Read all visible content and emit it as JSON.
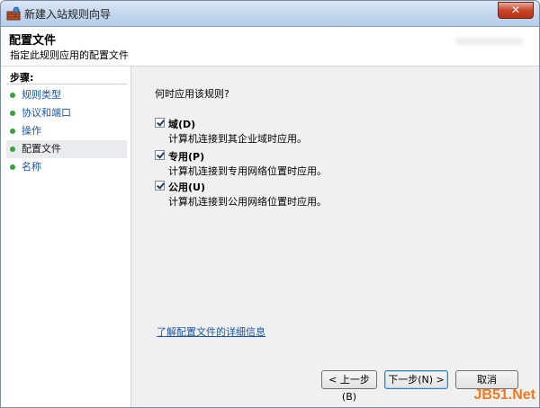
{
  "window": {
    "title": "新建入站规则向导",
    "close_glyph": "✕"
  },
  "header": {
    "title": "配置文件",
    "subtitle": "指定此规则应用的配置文件"
  },
  "sidebar": {
    "steps_label": "步骤:",
    "items": [
      {
        "label": "规则类型",
        "active": false
      },
      {
        "label": "协议和端口",
        "active": false
      },
      {
        "label": "操作",
        "active": false
      },
      {
        "label": "配置文件",
        "active": true
      },
      {
        "label": "名称",
        "active": false
      }
    ]
  },
  "content": {
    "question": "何时应用该规则?",
    "options": [
      {
        "label": "域(D)",
        "description": "计算机连接到其企业域时应用。",
        "checked": true
      },
      {
        "label": "专用(P)",
        "description": "计算机连接到专用网络位置时应用。",
        "checked": true
      },
      {
        "label": "公用(U)",
        "description": "计算机连接到公用网络位置时应用。",
        "checked": true
      }
    ],
    "learn_more": "了解配置文件的详细信息"
  },
  "buttons": {
    "back": "< 上一步(B)",
    "next": "下一步(N) >",
    "cancel": "取消"
  },
  "watermark": "JB51.Net",
  "colors": {
    "link": "#1a56a8",
    "step_dot": "#3aa13a",
    "close_red": "#c7452b",
    "watermark": "#ef7a20"
  }
}
